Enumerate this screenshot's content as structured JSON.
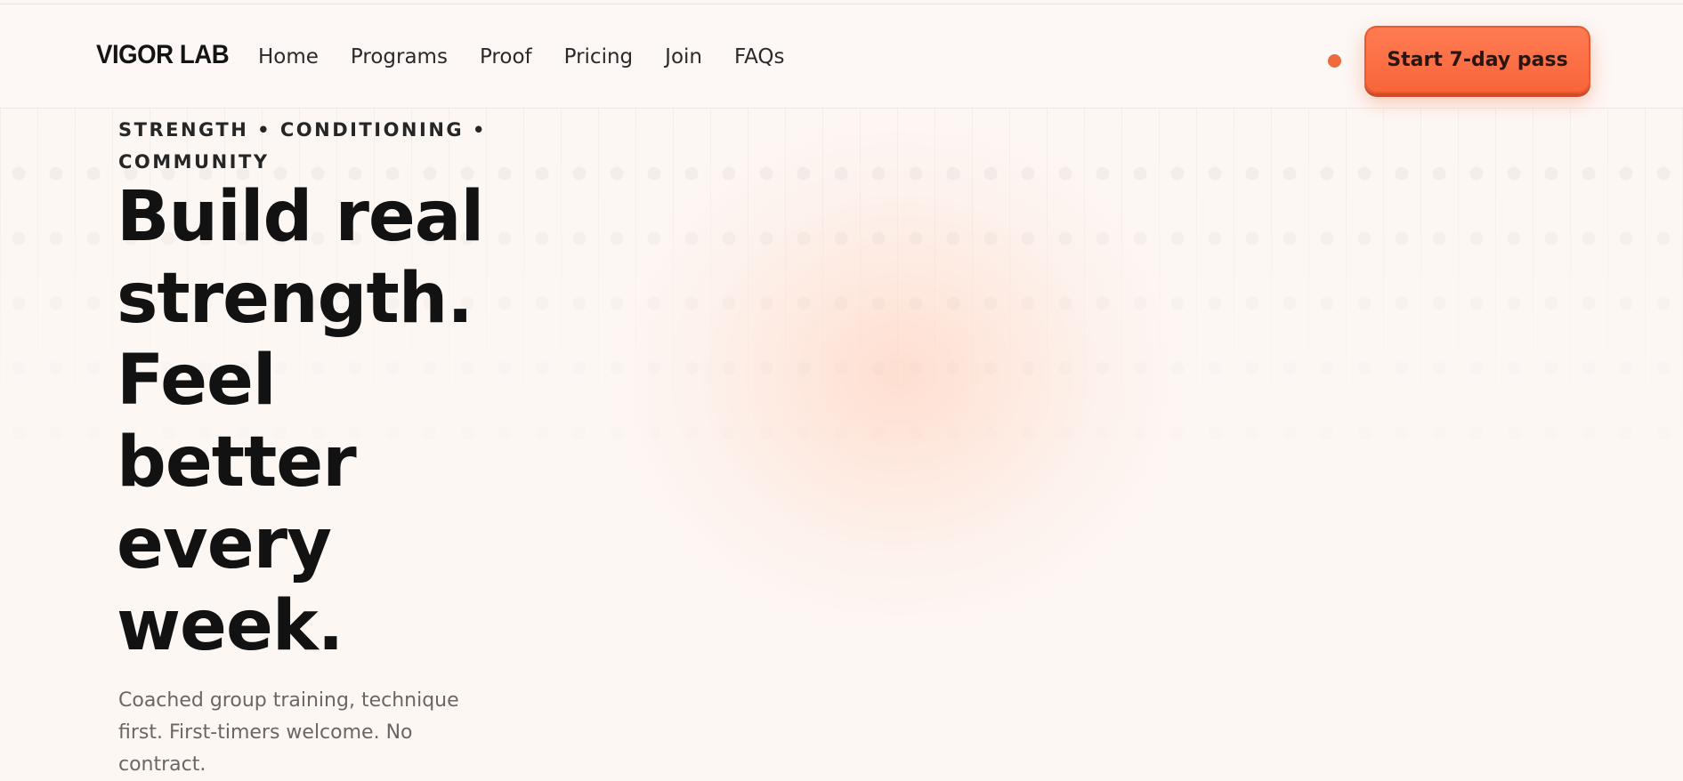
{
  "brand": {
    "logo": "VIGOR LAB",
    "accent_color": "#f06a3c"
  },
  "nav": {
    "items": [
      {
        "label": "Home"
      },
      {
        "label": "Programs"
      },
      {
        "label": "Proof"
      },
      {
        "label": "Pricing"
      },
      {
        "label": "Join"
      },
      {
        "label": "FAQs"
      }
    ]
  },
  "header": {
    "status_icon": "status-dot-icon",
    "cta_label": "Start 7-day pass"
  },
  "hero": {
    "eyebrow": "STRENGTH • CONDITIONING • COMMUNITY",
    "headline": "Build real strength. Feel better every week.",
    "subtext": "Coached group training, technique first. First-timers welcome. No contract."
  }
}
